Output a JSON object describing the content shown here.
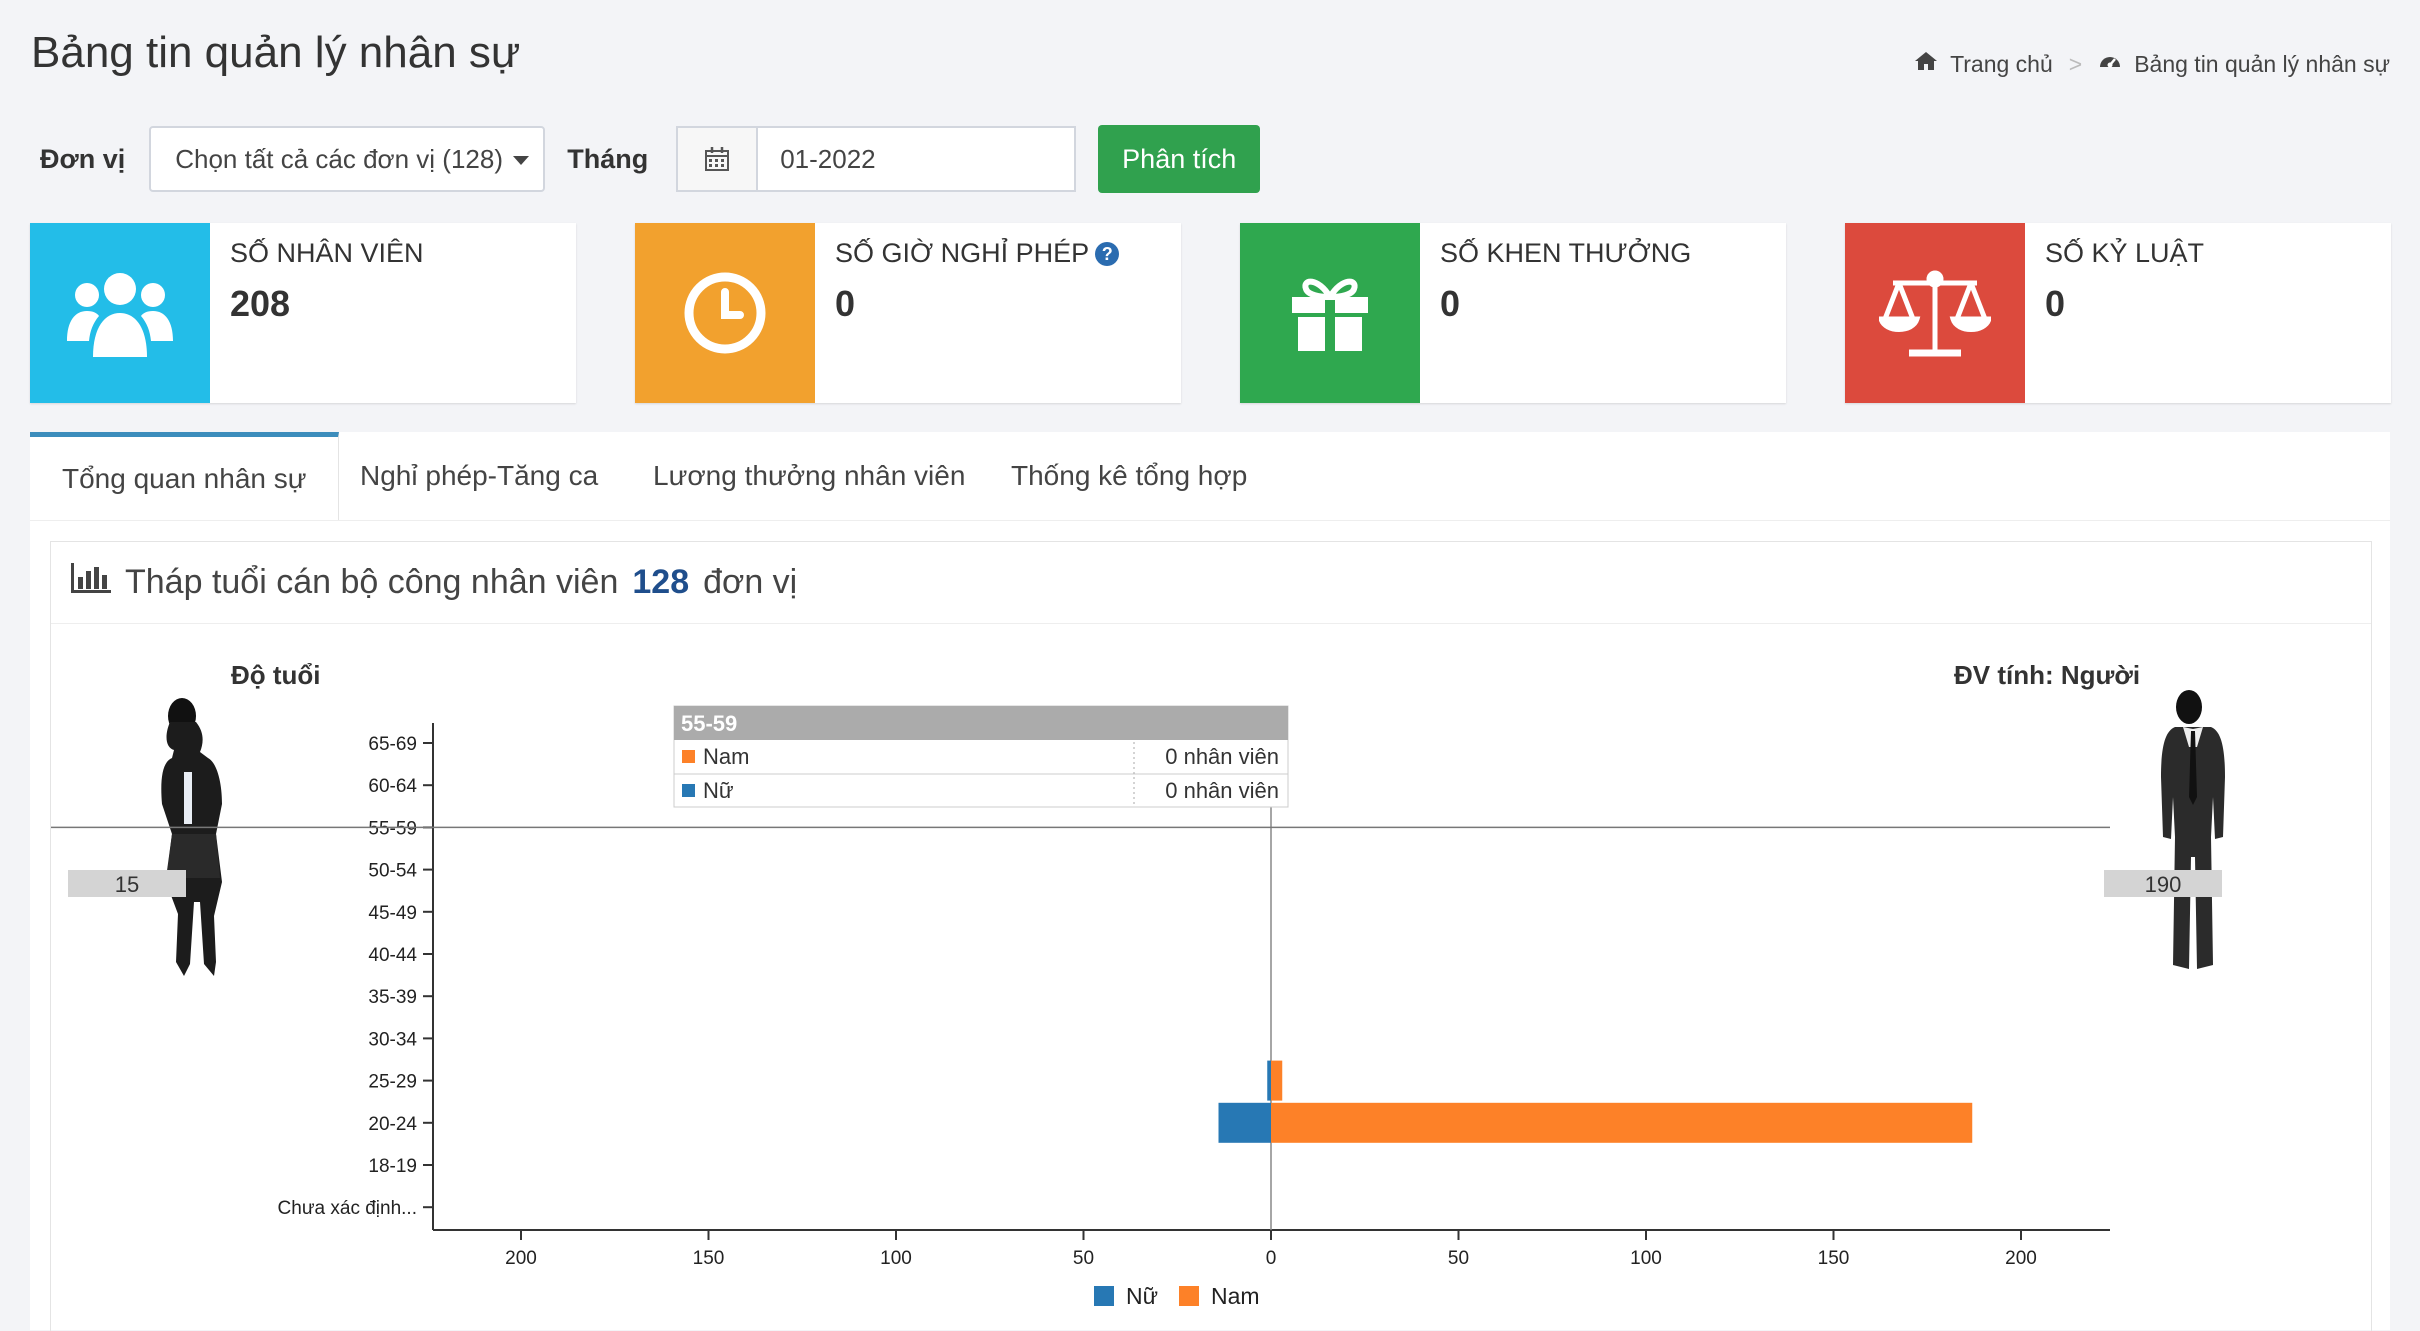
{
  "header": {
    "title": "Bảng tin quản lý nhân sự",
    "breadcrumb": [
      "Trang chủ",
      "Bảng tin quản lý nhân sự"
    ]
  },
  "filters": {
    "unit_label": "Đơn vị",
    "unit_value": "Chọn tất cả các đơn vị (128)",
    "month_label": "Tháng",
    "month_value": "01-2022",
    "analyze_button": "Phân tích"
  },
  "cards": [
    {
      "title": "SỐ NHÂN VIÊN",
      "value": "208",
      "color": "#23bde8",
      "icon": "users-icon"
    },
    {
      "title": "SỐ GIỜ NGHỈ PHÉP",
      "value": "0",
      "color": "#f2a12e",
      "icon": "clock-icon"
    },
    {
      "title": "SỐ KHEN THƯỞNG",
      "value": "0",
      "color": "#2fa84f",
      "icon": "gift-icon"
    },
    {
      "title": "SỐ KỶ LUẬT",
      "value": "0",
      "color": "#dc4a3d",
      "icon": "balance-scale-icon"
    }
  ],
  "tabs": [
    "Tổng quan nhân sự",
    "Nghỉ phép-Tăng ca",
    "Lương thưởng nhân viên",
    "Thống kê tổng hợp"
  ],
  "section": {
    "title_prefix": "Tháp tuổi cán bộ công nhân viên",
    "unit_count": "128",
    "title_suffix": "đơn vị"
  },
  "pyramid": {
    "female_total": "15",
    "male_total": "190"
  },
  "tooltip": {
    "title": "55-59",
    "rows": [
      {
        "name": "Nam",
        "value": "0 nhân viên",
        "color": "#fd8128"
      },
      {
        "name": "Nữ",
        "value": "0 nhân viên",
        "color": "#2778b4"
      }
    ]
  },
  "chart_data": {
    "type": "bar",
    "orientation": "horizontal-pyramid",
    "xlabel": "Độ tuổi",
    "ylabel": "ĐV tính: Người",
    "categories": [
      "65-69",
      "60-64",
      "55-59",
      "50-54",
      "45-49",
      "40-44",
      "35-39",
      "30-34",
      "25-29",
      "20-24",
      "18-19",
      "Chưa xác định..."
    ],
    "series": [
      {
        "name": "Nữ",
        "color": "#2778b4",
        "values": [
          0,
          0,
          0,
          0,
          0,
          0,
          0,
          0,
          1,
          14,
          0,
          0
        ]
      },
      {
        "name": "Nam",
        "color": "#fd8128",
        "values": [
          0,
          0,
          0,
          0,
          0,
          0,
          0,
          0,
          3,
          187,
          0,
          0
        ]
      }
    ],
    "xlim": [
      -200,
      200
    ],
    "xticks": [
      "200",
      "150",
      "100",
      "50",
      "0",
      "50",
      "100",
      "150",
      "200"
    ],
    "legend": "bottom",
    "grid": false
  }
}
